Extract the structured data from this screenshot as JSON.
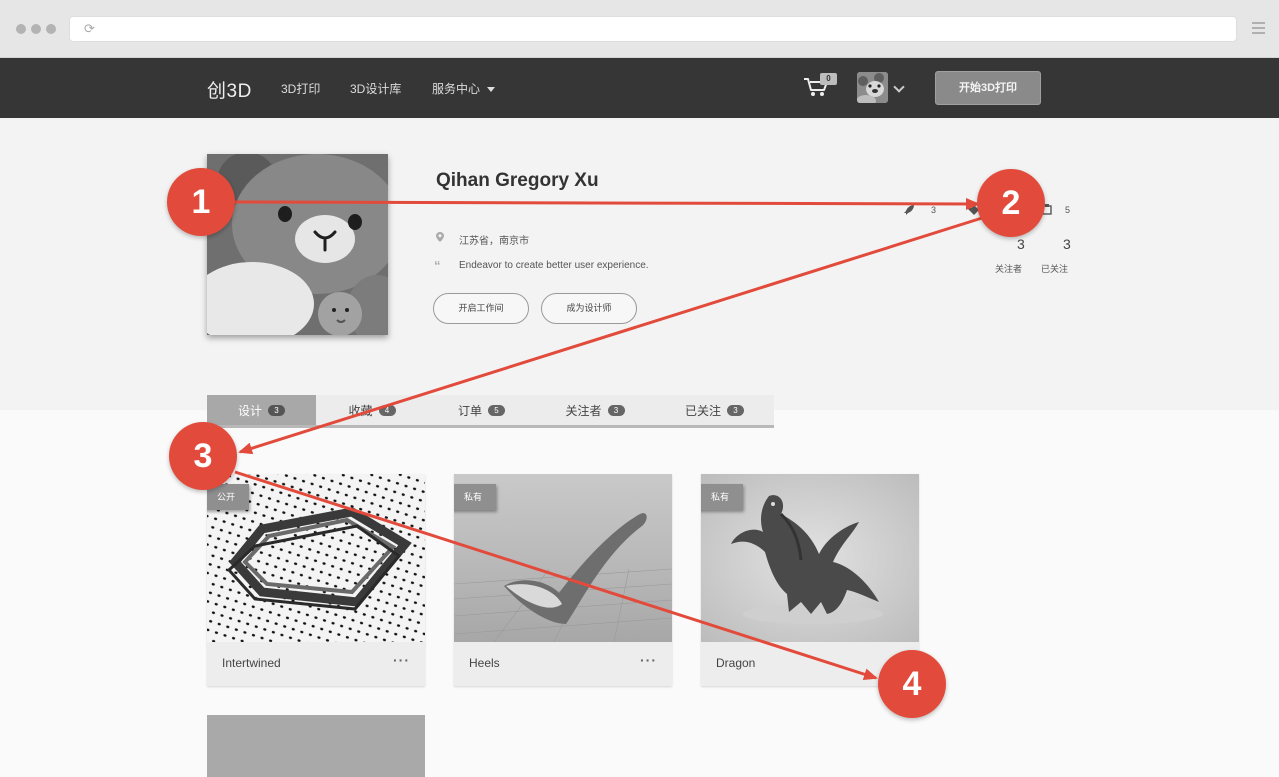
{
  "navbar": {
    "logo": "创3D",
    "links": [
      "3D打印",
      "3D设计库",
      "服务中心"
    ],
    "cart_count": "0",
    "start_button": "开始3D打印"
  },
  "profile": {
    "name": "Qihan Gregory Xu",
    "location": "江苏省，南京市",
    "bio": "Endeavor to create better user experience.",
    "buttons": [
      "开启工作间",
      "成为设计师"
    ],
    "stats": [
      {
        "icon": "rocket-icon",
        "count": "3"
      },
      {
        "icon": "tag-icon",
        "count": ""
      },
      {
        "icon": "box-icon",
        "count": "5"
      }
    ],
    "follow": [
      {
        "value": "3",
        "label": "关注者"
      },
      {
        "value": "3",
        "label": "已关注"
      }
    ]
  },
  "tabs": [
    {
      "label": "设计",
      "count": "3",
      "active": true
    },
    {
      "label": "收藏",
      "count": "4",
      "active": false
    },
    {
      "label": "订单",
      "count": "5",
      "active": false
    },
    {
      "label": "关注者",
      "count": "3",
      "active": false
    },
    {
      "label": "已关注",
      "count": "3",
      "active": false
    }
  ],
  "cards": [
    {
      "title": "Intertwined",
      "flag": "公开",
      "more": "···"
    },
    {
      "title": "Heels",
      "flag": "私有",
      "more": "···"
    },
    {
      "title": "Dragon",
      "flag": "私有",
      "more": ""
    }
  ],
  "annotations": {
    "markers": [
      "1",
      "2",
      "3",
      "4"
    ],
    "color": "#e24b3b"
  },
  "colors": {
    "navbar_bg": "#363636",
    "profile_bg": "#f3f3f3",
    "accent": "#e24b3b"
  }
}
